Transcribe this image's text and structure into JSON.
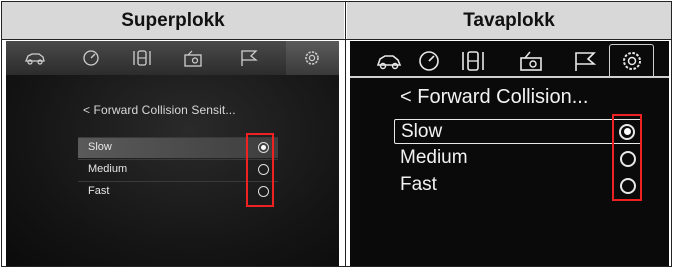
{
  "columns": {
    "left_header": "Superplokk",
    "right_header": "Tavaplokk"
  },
  "super_panel": {
    "title": "< Forward Collision Sensit...",
    "options": [
      {
        "label": "Slow",
        "selected": true
      },
      {
        "label": "Medium",
        "selected": false
      },
      {
        "label": "Fast",
        "selected": false
      }
    ],
    "icons": [
      "car-icon",
      "gauge-icon",
      "fuel-icon",
      "camera-icon",
      "flag-icon",
      "gear-icon"
    ]
  },
  "tava_panel": {
    "title": "< Forward Collision...",
    "options": [
      {
        "label": "Slow",
        "selected": true
      },
      {
        "label": "Medium",
        "selected": false
      },
      {
        "label": "Fast",
        "selected": false
      }
    ],
    "icons": [
      "car-icon",
      "gauge-icon",
      "fuel-icon",
      "camera-icon",
      "flag-icon",
      "gear-icon"
    ]
  },
  "colors": {
    "highlight_box": "#e22222",
    "screen_background": "#0a0a0a",
    "header_background": "#d8d8d8"
  }
}
